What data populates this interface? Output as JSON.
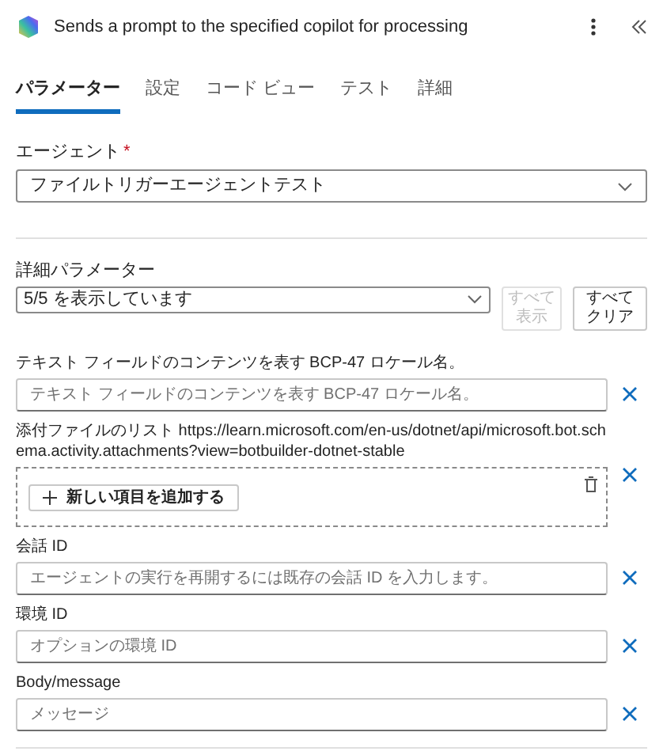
{
  "header": {
    "title": "Sends a prompt to the specified copilot for processing"
  },
  "tabs": [
    {
      "label": "パラメーター",
      "selected": true
    },
    {
      "label": "設定",
      "selected": false
    },
    {
      "label": "コード ビュー",
      "selected": false
    },
    {
      "label": "テスト",
      "selected": false
    },
    {
      "label": "詳細",
      "selected": false
    }
  ],
  "agent": {
    "label": "エージェント",
    "required_mark": "*",
    "value": "ファイルトリガーエージェントテスト"
  },
  "advanced": {
    "label": "詳細パラメーター",
    "value": "5/5 を表示しています",
    "buttons": [
      {
        "label": "すべて表示",
        "disabled": true
      },
      {
        "label": "すべてクリア",
        "disabled": false
      }
    ]
  },
  "fields": [
    {
      "kind": "text",
      "label": "テキスト フィールドのコンテンツを表す BCP-47 ロケール名。",
      "placeholder": "テキスト フィールドのコンテンツを表す BCP-47 ロケール名。"
    },
    {
      "kind": "array",
      "label": "添付ファイルのリスト https://learn.microsoft.com/en-us/dotnet/api/microsoft.bot.schema.activity.attachments?view=botbuilder-dotnet-stable",
      "add_label": "新しい項目を追加する"
    },
    {
      "kind": "text",
      "label": "会話 ID",
      "placeholder": "エージェントの実行を再開するには既存の会話 ID を入力します。"
    },
    {
      "kind": "text",
      "label": "環境 ID",
      "placeholder": "オプションの環境 ID"
    },
    {
      "kind": "text",
      "label": "Body/message",
      "placeholder": "メッセージ"
    }
  ]
}
